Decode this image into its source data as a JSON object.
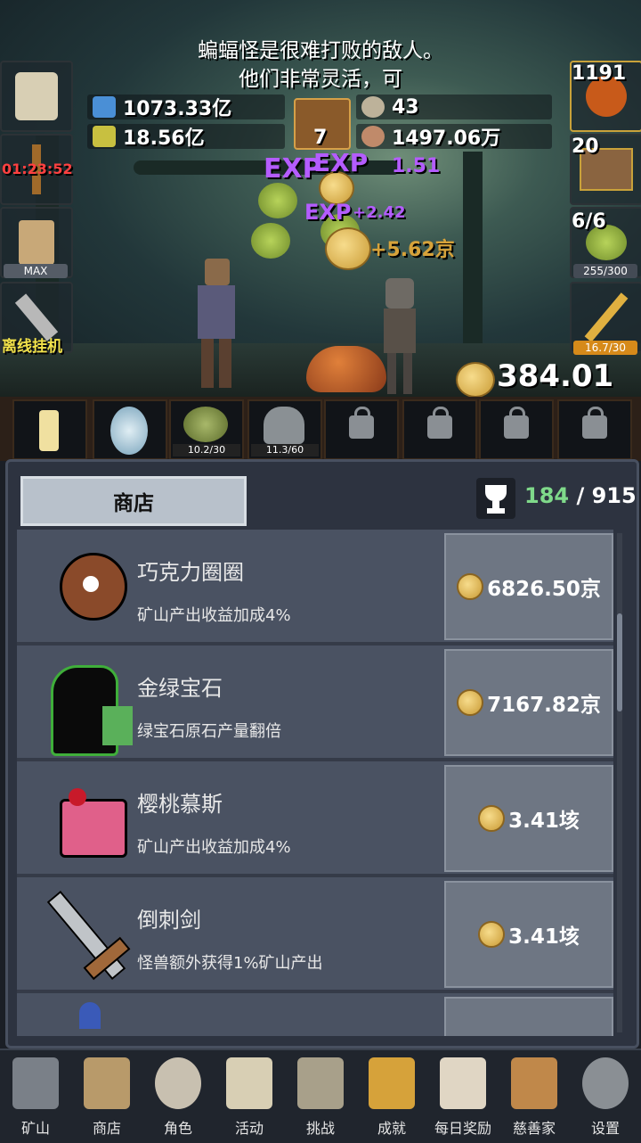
{
  "message": {
    "line1": "蝙蝠怪是很难打败的敌人。",
    "line2": "他们非常灵活，可"
  },
  "resources": {
    "potion_blue": "1073.33亿",
    "potion_yellow": "18.56亿",
    "book_count": "7",
    "coin_small": "43",
    "meat": "1497.06万"
  },
  "left_side": {
    "timer": "01:23:52",
    "beer_label": "MAX",
    "offline_label": "离线挂机"
  },
  "right_side": {
    "potion_count": "1191",
    "chest_count": "20",
    "slime_count": "6/6",
    "slime_progress": "255/300",
    "sword_progress": "16.7/30"
  },
  "floating_texts": {
    "exp1": "EXP",
    "exp2": "EXP",
    "exp3": "EXP",
    "gain1": "+5.62京",
    "gain2": "+2.42",
    "gain3": "1.51"
  },
  "gold_total": "384.01京",
  "slots": [
    {
      "icon": "candle-icon"
    },
    {
      "icon": "egg-icon"
    },
    {
      "icon": "slime-icon",
      "progress": "10.2/30"
    },
    {
      "icon": "ghost-icon",
      "progress": "11.3/60"
    },
    {
      "icon": "lock-icon"
    },
    {
      "icon": "lock-icon"
    },
    {
      "icon": "lock-icon"
    },
    {
      "icon": "lock-icon"
    }
  ],
  "panel": {
    "tab_label": "商店",
    "trophy_current": "184",
    "trophy_sep": " / ",
    "trophy_total": "915"
  },
  "shop_items": [
    {
      "name": "巧克力圈圈",
      "desc": "矿山产出收益加成4%",
      "price": "6826.50京",
      "icon": "donut-icon"
    },
    {
      "name": "金绿宝石",
      "desc": "绿宝石原石产量翻倍",
      "price": "7167.82京",
      "icon": "gem-silhouette-icon"
    },
    {
      "name": "樱桃慕斯",
      "desc": "矿山产出收益加成4%",
      "price": "3.41垓",
      "icon": "cake-icon"
    },
    {
      "name": "倒刺剑",
      "desc": "怪兽额外获得1%矿山产出",
      "price": "3.41垓",
      "icon": "sword-icon"
    }
  ],
  "nav": [
    {
      "label": "矿山",
      "icon": "lantern-icon"
    },
    {
      "label": "商店",
      "icon": "shop-icon"
    },
    {
      "label": "角色",
      "icon": "skull-icon"
    },
    {
      "label": "活动",
      "icon": "scroll-icon"
    },
    {
      "label": "挑战",
      "icon": "map-icon"
    },
    {
      "label": "成就",
      "icon": "key-icon"
    },
    {
      "label": "每日奖励",
      "icon": "letter-icon"
    },
    {
      "label": "慈善家",
      "icon": "bread-icon"
    },
    {
      "label": "设置",
      "icon": "gear-icon"
    }
  ],
  "colors": {
    "accent_green": "#7fd98a",
    "panel_bg": "#2d3340",
    "item_bg": "#4a5262",
    "price_btn": "#6e7683",
    "timer_red": "#ff4040",
    "exp_purple": "#b45cff"
  }
}
